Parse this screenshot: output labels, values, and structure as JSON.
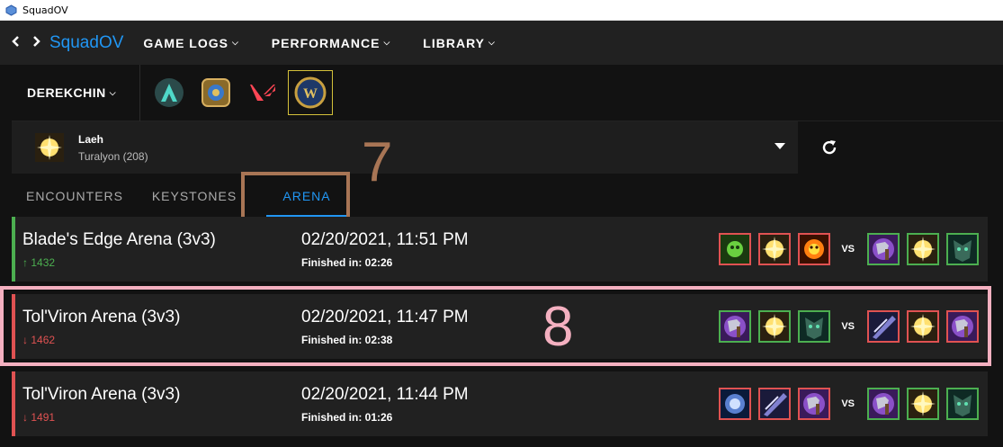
{
  "window": {
    "title": "SquadOV"
  },
  "nav": {
    "back_icon": "chevron-left-icon",
    "forward_icon": "chevron-right-icon",
    "brand": "SquadOV",
    "menus": [
      {
        "label": "GAME LOGS"
      },
      {
        "label": "PERFORMANCE"
      },
      {
        "label": "LIBRARY"
      }
    ]
  },
  "user": {
    "name": "DEREKCHIN"
  },
  "games": [
    {
      "name": "aimlab-icon"
    },
    {
      "name": "hearthstone-icon"
    },
    {
      "name": "valorant-icon"
    },
    {
      "name": "wow-icon",
      "selected": true
    }
  ],
  "character": {
    "name": "Laeh",
    "realm": "Turalyon (208)"
  },
  "tabs": [
    {
      "label": "ENCOUNTERS"
    },
    {
      "label": "KEYSTONES"
    },
    {
      "label": "ARENA",
      "active": true
    }
  ],
  "annotations": {
    "first": "7",
    "second": "8"
  },
  "matches": [
    {
      "map": "Blade's Edge Arena (3v3)",
      "rating": "1432",
      "rating_arrow": "↑",
      "result": "win",
      "date": "02/20/2021, 11:51 PM",
      "finished": "Finished in: 02:26",
      "vs": "VS",
      "team1": [
        "affliction",
        "holy",
        "destruction"
      ],
      "team2": [
        "arms",
        "holy",
        "windwalker"
      ]
    },
    {
      "map": "Tol'Viron Arena (3v3)",
      "rating": "1462",
      "rating_arrow": "↓",
      "result": "loss",
      "date": "02/20/2021, 11:47 PM",
      "finished": "Finished in: 02:38",
      "vs": "VS",
      "team1": [
        "arms",
        "holy",
        "windwalker"
      ],
      "team2": [
        "shadow",
        "holy",
        "arms"
      ]
    },
    {
      "map": "Tol'Viron Arena (3v3)",
      "rating": "1491",
      "rating_arrow": "↓",
      "result": "loss",
      "date": "02/20/2021, 11:44 PM",
      "finished": "Finished in: 01:26",
      "vs": "VS",
      "team1": [
        "frost",
        "shadow",
        "arms"
      ],
      "team2": [
        "arms",
        "holy",
        "windwalker"
      ]
    }
  ],
  "colors": {
    "win": "#4caf50",
    "loss": "#e05252",
    "accent": "#2196f3"
  }
}
